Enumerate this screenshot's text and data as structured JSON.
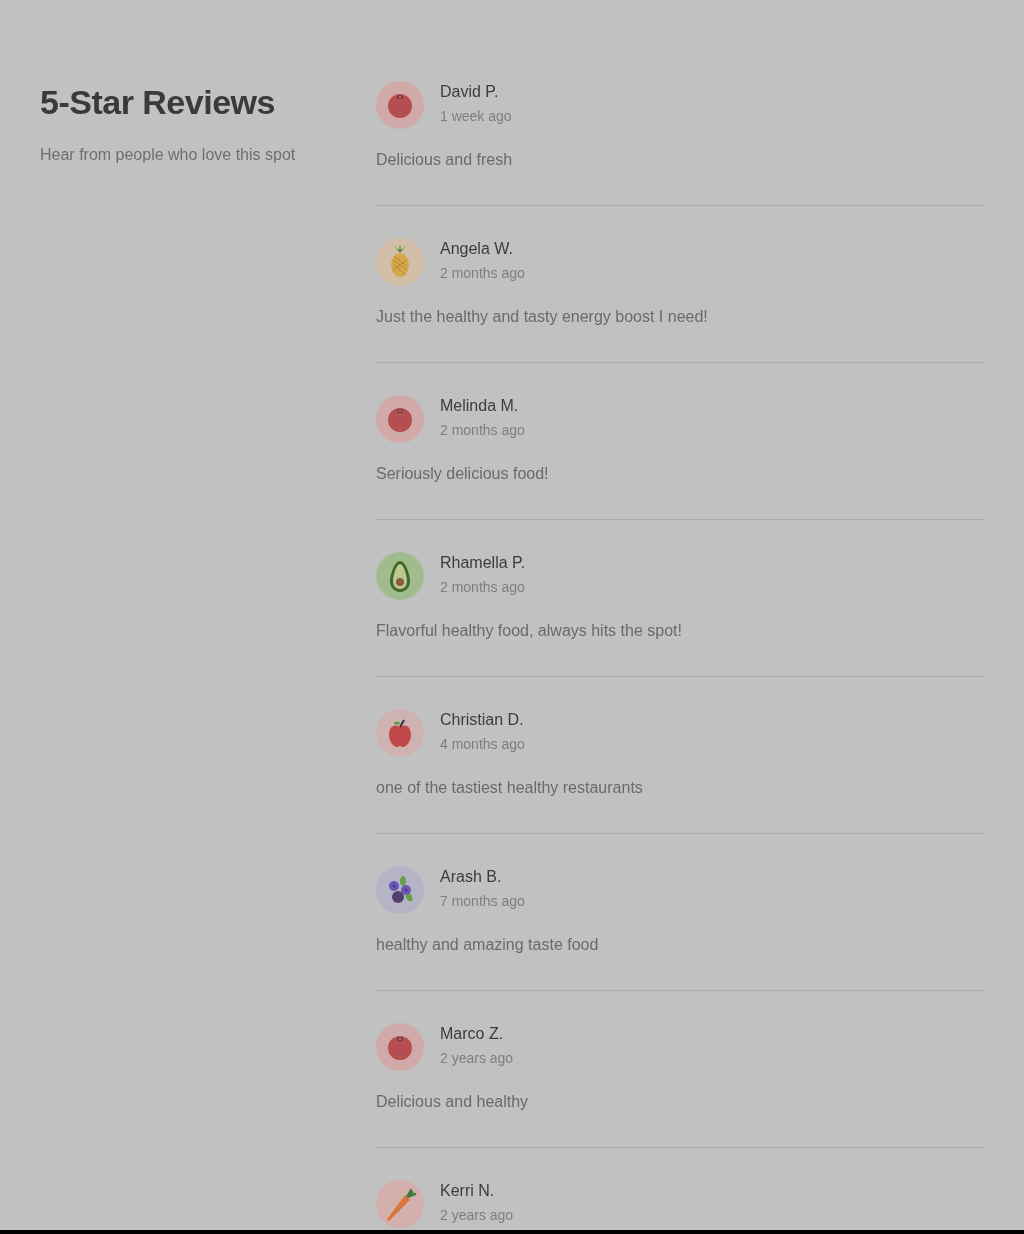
{
  "heading": "5-Star Reviews",
  "subheading": "Hear from people who love this spot",
  "reviews": [
    {
      "name": "David P.",
      "time": "1 week ago",
      "text": "Delicious and fresh",
      "kind": "tomato"
    },
    {
      "name": "Angela W.",
      "time": "2 months ago",
      "text": "Just the healthy and tasty energy boost I need!",
      "kind": "pineapple"
    },
    {
      "name": "Melinda M.",
      "time": "2 months ago",
      "text": "Seriously delicious food!",
      "kind": "tomato"
    },
    {
      "name": "Rhamella P.",
      "time": "2 months ago",
      "text": "Flavorful healthy food, always hits the spot!",
      "kind": "avocado"
    },
    {
      "name": "Christian D.",
      "time": "4 months ago",
      "text": "one of the tastiest healthy restaurants",
      "kind": "apple"
    },
    {
      "name": "Arash B.",
      "time": "7 months ago",
      "text": "healthy and amazing taste food",
      "kind": "blueberry"
    },
    {
      "name": "Marco Z.",
      "time": "2 years ago",
      "text": "Delicious and healthy",
      "kind": "tomato"
    },
    {
      "name": "Kerri N.",
      "time": "2 years ago",
      "kind": "carrot"
    }
  ]
}
